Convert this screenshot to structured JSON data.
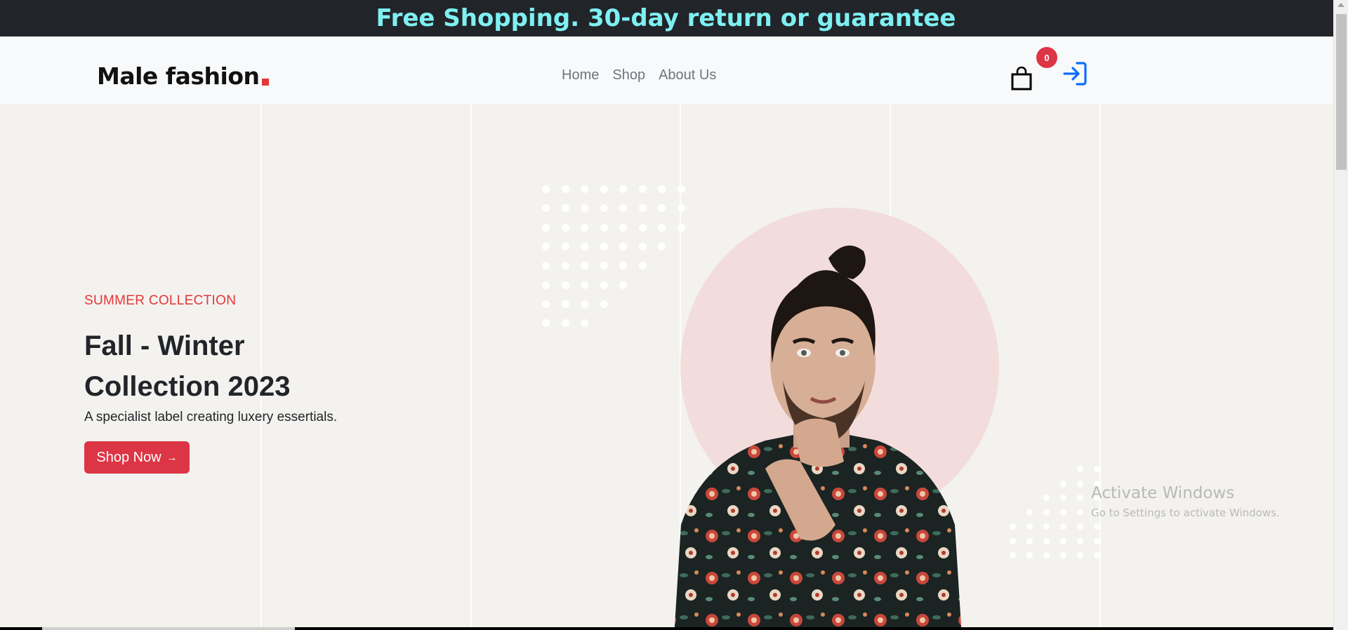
{
  "topbar": {
    "text": "Free Shopping. 30-day return or guarantee"
  },
  "header": {
    "logo_text": "Male fashion",
    "nav": [
      {
        "label": "Home"
      },
      {
        "label": "Shop"
      },
      {
        "label": "About Us"
      }
    ],
    "cart_count": "0",
    "icons": {
      "cart": "shopping-bag-icon",
      "login": "login-arrow-icon"
    }
  },
  "hero": {
    "subtitle": "SUMMER COLLECTION",
    "title_line1": "Fall - Winter",
    "title_line2": "Collection 2023",
    "description": "A specialist label creating luxery essertials.",
    "button_label": "Shop Now",
    "button_icon": "arrow-right-icon",
    "image": "male-model-floral-shirt"
  },
  "watermark": {
    "line1": "Activate Windows",
    "line2": "Go to Settings to activate Windows."
  },
  "colors": {
    "topbar_bg": "#212529",
    "topbar_text": "#7ff0f2",
    "accent": "#dc3545",
    "hero_bg": "#f3f2ee",
    "circle": "#f3dcdc",
    "login_icon": "#0d6efd"
  }
}
